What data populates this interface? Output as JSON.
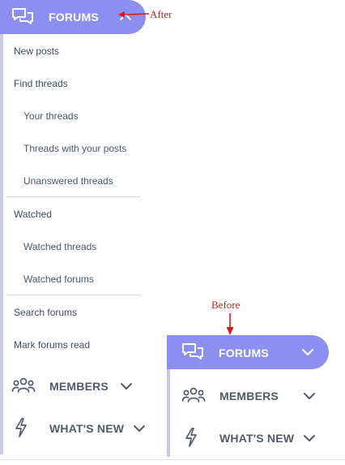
{
  "after_panel": {
    "header": {
      "label": "FORUMS",
      "icon": "chat-bubbles-icon",
      "chevron": "chevron-up-icon"
    },
    "menu": {
      "new_posts": "New posts",
      "find_threads": "Find threads",
      "your_threads": "Your threads",
      "threads_with_posts": "Threads with your posts",
      "unanswered_threads": "Unanswered threads",
      "watched": "Watched",
      "watched_threads": "Watched threads",
      "watched_forums": "Watched forums",
      "search_forums": "Search forums",
      "mark_forums_read": "Mark forums read"
    },
    "members": {
      "label": "MEMBERS",
      "icon": "members-icon"
    },
    "whats_new": {
      "label": "WHAT'S NEW",
      "icon": "lightning-icon"
    }
  },
  "before_panel": {
    "header": {
      "label": "FORUMS",
      "icon": "chat-bubbles-icon",
      "chevron": "chevron-down-icon"
    },
    "members": {
      "label": "MEMBERS",
      "icon": "members-icon"
    },
    "whats_new": {
      "label": "WHAT'S NEW",
      "icon": "lightning-icon"
    }
  },
  "annotations": {
    "after": "After",
    "before": "Before"
  },
  "colors": {
    "accent": "#8a8ff0",
    "annotation": "#d11b1b",
    "text": "#4f5a70"
  }
}
